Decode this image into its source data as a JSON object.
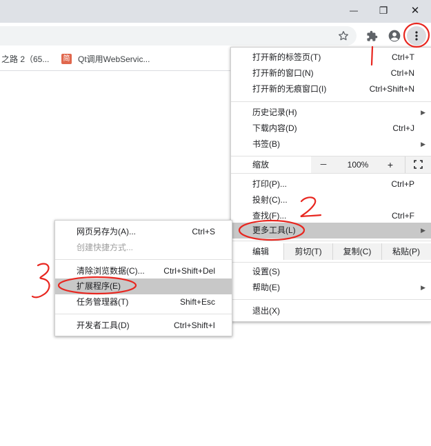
{
  "window": {
    "minimize_glyph": "—",
    "restore_glyph": "❐",
    "close_glyph": "✕"
  },
  "bookmarks": [
    {
      "label": "之路 2（65..."
    },
    {
      "icon_text": "简",
      "label": "Qt调用WebServic..."
    }
  ],
  "main_menu": {
    "items": [
      {
        "label": "打开新的标签页(T)",
        "shortcut": "Ctrl+T"
      },
      {
        "label": "打开新的窗口(N)",
        "shortcut": "Ctrl+N"
      },
      {
        "label": "打开新的无痕窗口(I)",
        "shortcut": "Ctrl+Shift+N"
      },
      {
        "label": "历史记录(H)",
        "arrow": "▶"
      },
      {
        "label": "下载内容(D)",
        "shortcut": "Ctrl+J"
      },
      {
        "label": "书签(B)",
        "arrow": "▶"
      },
      {
        "label": "打印(P)...",
        "shortcut": "Ctrl+P"
      },
      {
        "label": "投射(C)..."
      },
      {
        "label": "查找(F)...",
        "shortcut": "Ctrl+F"
      },
      {
        "label": "更多工具(L)",
        "arrow": "▶"
      },
      {
        "label": "设置(S)"
      },
      {
        "label": "帮助(E)",
        "arrow": "▶"
      },
      {
        "label": "退出(X)"
      }
    ],
    "zoom": {
      "label": "缩放",
      "minus": "－",
      "value": "100%",
      "plus": "+"
    },
    "edit": {
      "label": "编辑",
      "cut": "剪切(T)",
      "copy": "复制(C)",
      "paste": "粘贴(P)"
    }
  },
  "sub_menu": {
    "items": [
      {
        "label": "网页另存为(A)...",
        "shortcut": "Ctrl+S"
      },
      {
        "label": "创建快捷方式..."
      },
      {
        "label": "清除浏览数据(C)...",
        "shortcut": "Ctrl+Shift+Del"
      },
      {
        "label": "扩展程序(E)"
      },
      {
        "label": "任务管理器(T)",
        "shortcut": "Shift+Esc"
      },
      {
        "label": "开发者工具(D)",
        "shortcut": "Ctrl+Shift+I"
      }
    ]
  },
  "annotations": {
    "step1": "1",
    "step2": "2",
    "step3": "3",
    "ink_color": "#e8261f"
  }
}
